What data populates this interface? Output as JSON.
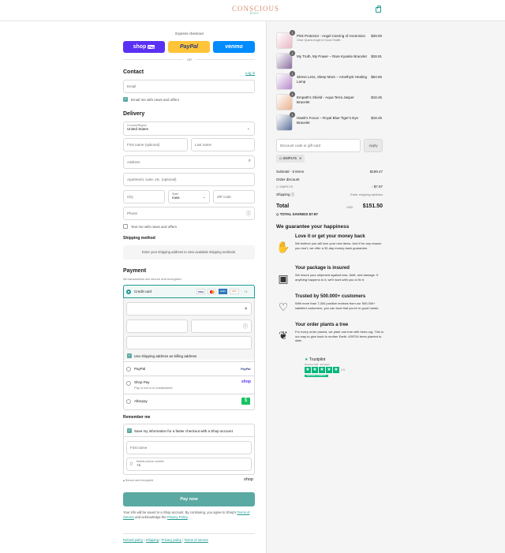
{
  "header": {
    "logo_main": "CONSCIOUS",
    "logo_sub": "Items"
  },
  "express": {
    "title": "Express checkout",
    "shop_pay": "shop",
    "shop_pay_badge": "Pay",
    "paypal": "PayPal",
    "venmo": "venmo",
    "or": "OR"
  },
  "contact": {
    "heading": "Contact",
    "login_link": "Log in",
    "email_placeholder": "Email",
    "newsletter_label": "Email me with news and offers"
  },
  "delivery": {
    "heading": "Delivery",
    "country_label": "Country/Region",
    "country_value": "United States",
    "first_name": "First name (optional)",
    "last_name": "Last name",
    "address": "Address",
    "apartment": "Apartment, suite, etc. (optional)",
    "city": "City",
    "state_label": "State",
    "state_value": "Iowa",
    "zip": "ZIP code",
    "phone": "Phone",
    "text_offers": "Text me with news and offers"
  },
  "shipping": {
    "heading": "Shipping method",
    "notice": "Enter your shipping address to view available shipping methods."
  },
  "payment": {
    "heading": "Payment",
    "subtitle": "All transactions are secure and encrypted.",
    "credit_card": "Credit card",
    "cards": [
      "VISA",
      "MC",
      "AMEX",
      "DISC",
      "+1"
    ],
    "billing_same": "Use shipping address as billing address",
    "paypal": "PayPal",
    "paypal_logo": "PayPal",
    "shop_pay": "Shop Pay",
    "shop_pay_sub": "Pay in full or in installments",
    "shop_pay_logo": "shop",
    "afterpay": "Afterpay",
    "afterpay_logo": "$"
  },
  "remember": {
    "heading": "Remember me",
    "save_label": "Save my information for a faster checkout with a Shop account",
    "first_name": "First name",
    "mobile_label": "Mobile phone number",
    "mobile_value": "+1",
    "secure": "Secure and encrypted",
    "shop_logo": "shop"
  },
  "pay_button": "Pay now",
  "terms": {
    "text1": "Your info will be saved to a Shop account. By continuing, you agree to Shop's",
    "tos": "Terms of Service",
    "text2": "and acknowledge the",
    "privacy": "Privacy Policy",
    "end": "."
  },
  "footer_links": [
    "Refund policy",
    "Shipping",
    "Privacy policy",
    "Terms of service"
  ],
  "cart": {
    "items": [
      {
        "name": "Pink Protector - Angel Carving of Ascension",
        "variant": "Clear Quartz Angel of Good Health",
        "price": "$29.00",
        "qty": "1",
        "color": "#e9b8c4"
      },
      {
        "name": "My Truth, My Power – Rare Kyanite Bracelet",
        "variant": "",
        "price": "$28.91",
        "qty": "1",
        "color": "#8a6e9e"
      },
      {
        "name": "Stress Less, Sleep More – Amethyst Healing Lamp",
        "variant": "",
        "price": "$64.66",
        "qty": "1",
        "color": "#b78acb"
      },
      {
        "name": "Empath's Shield - Aqua Terra Jasper Bracelet",
        "variant": "",
        "price": "$18.45",
        "qty": "1",
        "color": "#e8b28f"
      },
      {
        "name": "Hawk's Focus – Royal Blue Tiger's Eye Bracelet",
        "variant": "",
        "price": "$18.45",
        "qty": "1",
        "color": "#5b6f9a"
      }
    ],
    "discount_placeholder": "Discount code or gift card",
    "apply": "Apply",
    "code_tag": "SIMPLY5",
    "subtotal_label": "Subtotal · 5 items",
    "subtotal": "$159.47",
    "order_discount_label": "Order discount",
    "discount_code": "SIMPLY5",
    "discount_value": "- $7.97",
    "shipping_label": "Shipping",
    "shipping_value": "Enter shipping address",
    "total_label": "Total",
    "currency": "USD",
    "total": "$151.50",
    "savings_label": "TOTAL SAVINGS",
    "savings": "$7.97"
  },
  "guarantee": {
    "heading": "We guarantee your happiness",
    "items": [
      {
        "title": "Love it or get your money back",
        "text": "We believe you will love your new items. And if for any reason you don't, we offer a 30-day money-back guarantee.",
        "icon": "handshake-icon",
        "glyph": "✋"
      },
      {
        "title": "Your package is insured",
        "text": "We insure your shipment against loss, theft, and damage. If anything happens to it, we'll work with you to fix it.",
        "icon": "package-icon",
        "glyph": "▣"
      },
      {
        "title": "Trusted by 500.000+ customers",
        "text": "With more than 7,000 positive reviews from our 500,000+ satisfied customers, you can trust that you're in good hands.",
        "icon": "heart-hands-icon",
        "glyph": "♡"
      },
      {
        "title": "Your order plants a tree",
        "text": "For every order placed, we plant one tree with trees.org. This is our way to give back to mother Earth. #39754 trees planted to date.",
        "icon": "plant-hand-icon",
        "glyph": "❦"
      }
    ]
  },
  "trustpilot": {
    "brand": "Trustpilot",
    "line": "Reviews 404 · Excellent",
    "score": "4.9",
    "badge": "VERIFIED COMPANY"
  },
  "colors": {
    "accent": "#1f9c93",
    "pay_button": "#5aa9a2",
    "shop_pay": "#5a31f4",
    "paypal": "#ffc439",
    "venmo": "#008cff",
    "trust_green": "#00b67a"
  }
}
